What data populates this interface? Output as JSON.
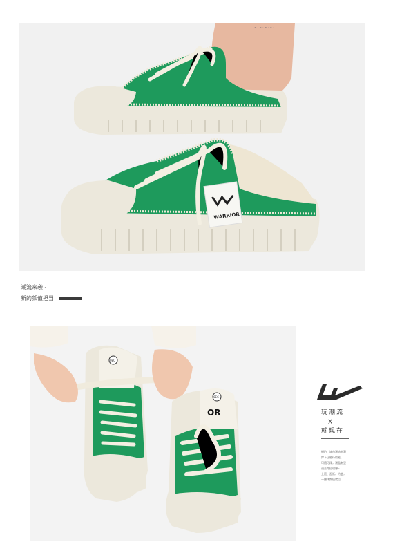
{
  "captions": {
    "line1": "潮流来袭 -",
    "line2": "新的颜值担当"
  },
  "product_tag": "WARRIOR",
  "insole_marks": {
    "size_mark": "0EC",
    "brand_mark": "OR"
  },
  "side_panel": {
    "slogan_line1": "玩潮流",
    "slogan_x": "X",
    "slogan_line2": "就现在",
    "paragraph": [
      "街拍、城市潮流街潮",
      "穿下正能行的鞋，",
      "可随可踩，潮酷有型",
      "通去穿搭理想─",
      "上班、逛街、约会，",
      "一整体颜值就位!"
    ]
  },
  "colors": {
    "canvas_green": "#1e9a5c",
    "sole_cream": "#ece8dc",
    "lace_cream": "#f3efe2",
    "background_gray": "#f1f1f1",
    "accent_dark": "#3b3b3b"
  }
}
